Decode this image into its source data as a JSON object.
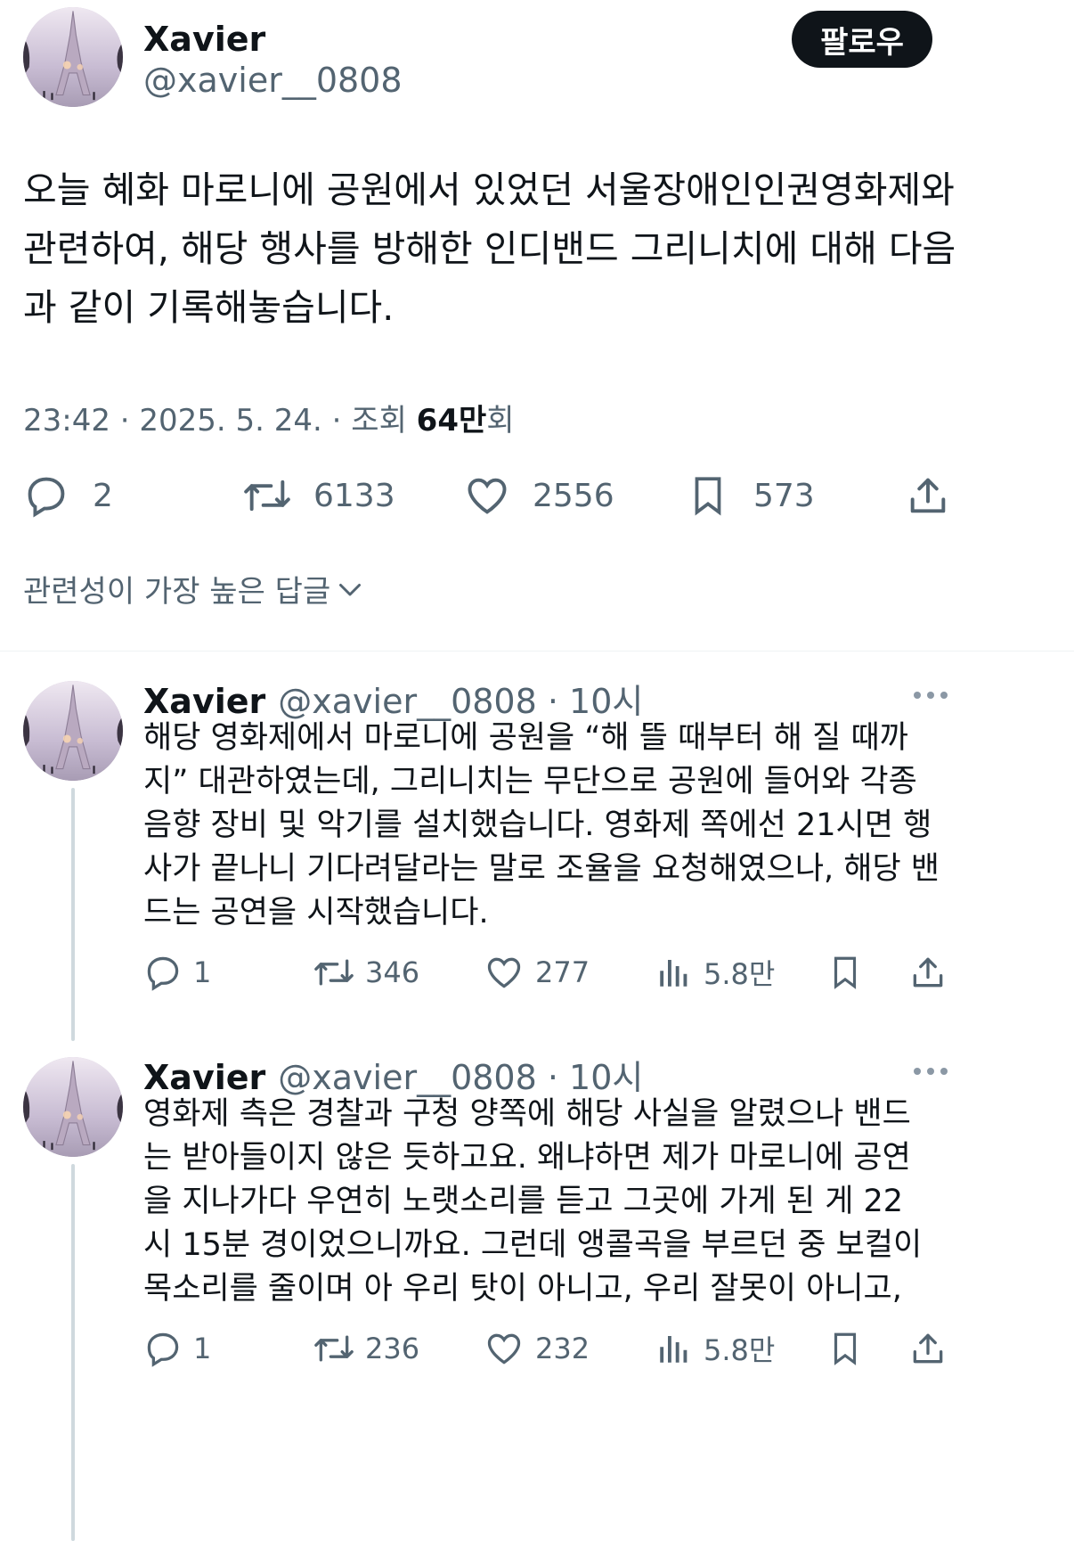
{
  "main": {
    "author_name": "Xavier",
    "author_handle": "@xavier__0808",
    "follow_label": "팔로우",
    "text_lines": [
      "오늘 혜화 마로니에 공원에서 있었던 서울장애인인권영화제와",
      "관련하여, 해당 행사를 방해한 인디밴드 그리니치에 대해 다음",
      "과 같이 기록해놓습니다."
    ],
    "time": "23:42 · 2025. 5. 24. · 조회",
    "views_number": "64만",
    "views_suffix": "회",
    "stats": {
      "replies": "2",
      "retweets": "6133",
      "likes": "2556",
      "bookmarks": "573"
    }
  },
  "sort_label": "관련성이 가장 높은 답글",
  "replies": [
    {
      "name": "Xavier",
      "handle_time": "@xavier__0808 · 10시",
      "lines": [
        "해당 영화제에서 마로니에 공원을 “해 뜰 때부터 해 질 때까",
        "지” 대관하였는데, 그리니치는 무단으로 공원에 들어와 각종",
        "음향 장비 및 악기를 설치했습니다. 영화제 쪽에선 21시면 행",
        "사가 끝나니 기다려달라는 말로 조율을 요청해였으나, 해당 밴",
        "드는 공연을 시작했습니다."
      ],
      "stats": {
        "replies": "1",
        "retweets": "346",
        "likes": "277",
        "views": "5.8만"
      }
    },
    {
      "name": "Xavier",
      "handle_time": "@xavier__0808 · 10시",
      "lines": [
        "영화제 측은 경찰과 구청 양쪽에 해당 사실을 알렸으나 밴드",
        "는 받아들이지 않은 듯하고요. 왜냐하면 제가 마로니에 공연",
        "을 지나가다 우연히 노랫소리를 듣고 그곳에 가게 된 게 22",
        "시 15분 경이었으니까요. 그런데 앵콜곡을 부르던 중 보컬이",
        "목소리를 줄이며 아 우리 탓이 아니고, 우리 잘못이 아니고,"
      ],
      "stats": {
        "replies": "1",
        "retweets": "236",
        "likes": "232",
        "views": "5.8만"
      }
    }
  ],
  "icons": {
    "reply": "reply-icon",
    "retweet": "retweet-icon",
    "like": "heart-icon",
    "bookmark": "bookmark-icon",
    "share": "share-icon",
    "views": "views-icon",
    "more": "more-icon",
    "chevron": "chevron-down-icon"
  },
  "colors": {
    "text": "#0f1419",
    "secondary": "#536471",
    "button": "#0f1419"
  }
}
